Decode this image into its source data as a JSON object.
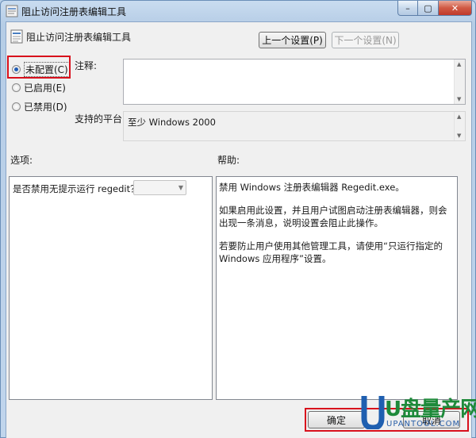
{
  "window": {
    "title": "阻止访问注册表编辑工具",
    "controls": {
      "minimize": "–",
      "maximize": "▢",
      "close": "✕"
    }
  },
  "header": {
    "policy_title": "阻止访问注册表编辑工具",
    "prev_button": "上一个设置(P)",
    "next_button": "下一个设置(N)"
  },
  "state": {
    "options": [
      {
        "label": "未配置(C)",
        "selected": true
      },
      {
        "label": "已启用(E)",
        "selected": false
      },
      {
        "label": "已禁用(D)",
        "selected": false
      }
    ]
  },
  "comment": {
    "label": "注释:",
    "value": ""
  },
  "platform": {
    "label": "支持的平台:",
    "value": "至少 Windows 2000"
  },
  "options_section": {
    "label": "选项:",
    "question": "是否禁用无提示运行 regedit？",
    "combo_value": ""
  },
  "help_section": {
    "label": "帮助:",
    "paragraphs": [
      "禁用 Windows 注册表编辑器 Regedit.exe。",
      "如果启用此设置，并且用户试图启动注册表编辑器，则会出现一条消息，说明设置会阻止此操作。",
      "若要防止用户使用其他管理工具，请使用“只运行指定的 Windows 应用程序”设置。"
    ]
  },
  "footer": {
    "ok_button": "确定",
    "cancel_button": "取消"
  },
  "watermark": {
    "text": "U盘量产网",
    "url": "UPANTOOL.COM"
  }
}
